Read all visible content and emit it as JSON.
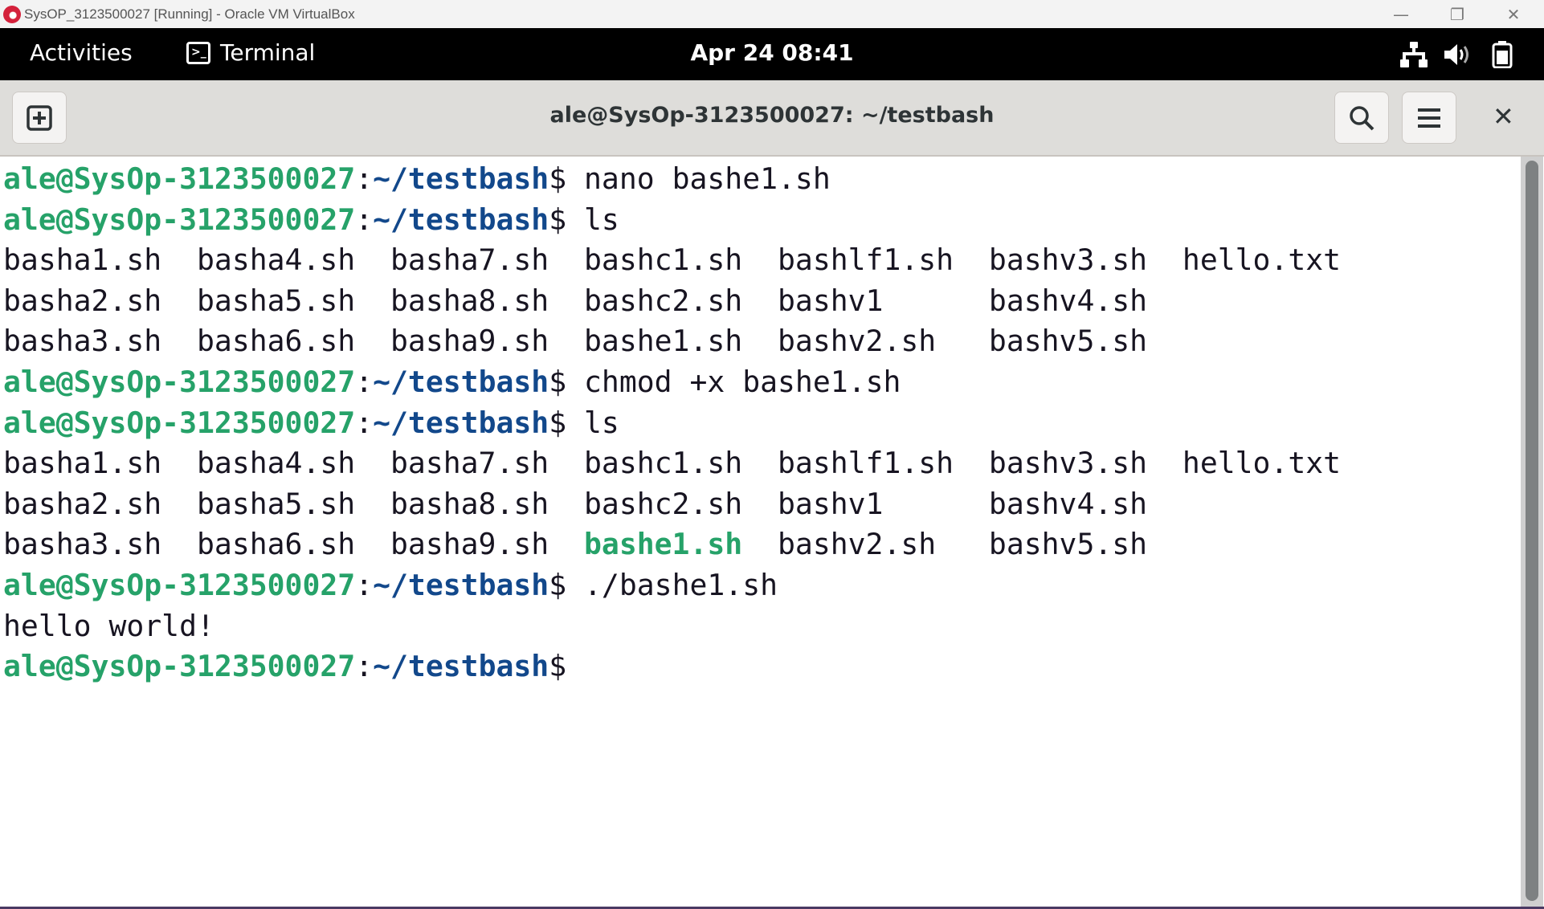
{
  "vbox": {
    "title": "SysOP_3123500027 [Running] - Oracle VM VirtualBox"
  },
  "topbar": {
    "activities": "Activities",
    "app": "Terminal",
    "clock": "Apr 24  08:41"
  },
  "header": {
    "title": "ale@SysOp-3123500027: ~/testbash"
  },
  "colors": {
    "green": "#26a269",
    "blue": "#12488b"
  },
  "lines": [
    [
      [
        "g",
        "ale@SysOp-3123500027"
      ],
      [
        "",
        ":"
      ],
      [
        "b",
        "~/testbash"
      ],
      [
        "",
        "$ nano bashe1.sh"
      ]
    ],
    [
      [
        "g",
        "ale@SysOp-3123500027"
      ],
      [
        "",
        ":"
      ],
      [
        "b",
        "~/testbash"
      ],
      [
        "",
        "$ ls"
      ]
    ],
    [
      [
        "",
        "basha1.sh  basha4.sh  basha7.sh  bashc1.sh  bashlf1.sh  bashv3.sh  hello.txt"
      ]
    ],
    [
      [
        "",
        "basha2.sh  basha5.sh  basha8.sh  bashc2.sh  bashv1      bashv4.sh"
      ]
    ],
    [
      [
        "",
        "basha3.sh  basha6.sh  basha9.sh  bashe1.sh  bashv2.sh   bashv5.sh"
      ]
    ],
    [
      [
        "g",
        "ale@SysOp-3123500027"
      ],
      [
        "",
        ":"
      ],
      [
        "b",
        "~/testbash"
      ],
      [
        "",
        "$ chmod +x bashe1.sh"
      ]
    ],
    [
      [
        "g",
        "ale@SysOp-3123500027"
      ],
      [
        "",
        ":"
      ],
      [
        "b",
        "~/testbash"
      ],
      [
        "",
        "$ ls"
      ]
    ],
    [
      [
        "",
        "basha1.sh  basha4.sh  basha7.sh  bashc1.sh  bashlf1.sh  bashv3.sh  hello.txt"
      ]
    ],
    [
      [
        "",
        "basha2.sh  basha5.sh  basha8.sh  bashc2.sh  bashv1      bashv4.sh"
      ]
    ],
    [
      [
        "",
        "basha3.sh  basha6.sh  basha9.sh  "
      ],
      [
        "g",
        "bashe1.sh"
      ],
      [
        "",
        "  bashv2.sh   bashv5.sh"
      ]
    ],
    [
      [
        "g",
        "ale@SysOp-3123500027"
      ],
      [
        "",
        ":"
      ],
      [
        "b",
        "~/testbash"
      ],
      [
        "",
        "$ ./bashe1.sh"
      ]
    ],
    [
      [
        "",
        "hello world!"
      ]
    ],
    [
      [
        "g",
        "ale@SysOp-3123500027"
      ],
      [
        "",
        ":"
      ],
      [
        "b",
        "~/testbash"
      ],
      [
        "",
        "$"
      ]
    ]
  ]
}
